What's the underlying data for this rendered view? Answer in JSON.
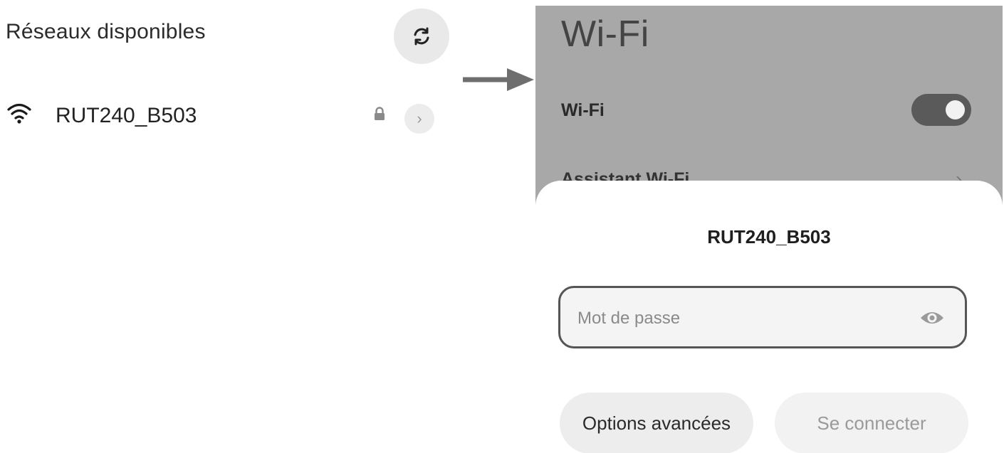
{
  "left_panel": {
    "section_title": "Réseaux disponibles",
    "refresh_icon": "refresh-icon",
    "network": {
      "name": "RUT240_B503",
      "signal_icon": "wifi-signal-icon",
      "secure_icon": "lock-icon",
      "detail_icon": "chevron-right-icon"
    }
  },
  "arrow_icon": "arrow-right-icon",
  "right_panel": {
    "screen_title": "Wi-Fi",
    "wifi_row": {
      "label": "Wi-Fi",
      "toggle_on": true
    },
    "assistant_row": {
      "label": "Assistant Wi-Fi"
    },
    "dialog": {
      "title": "RUT240_B503",
      "password_placeholder": "Mot de passe",
      "password_value": "",
      "visibility_icon": "eye-icon",
      "advanced_button": "Options avancées",
      "connect_button": "Se connecter"
    }
  },
  "colors": {
    "dim_overlay": "#a8a8a8",
    "toggle_track": "#5a5a5a",
    "field_border": "#555555",
    "button_bg": "#ededed",
    "disabled_text": "#9a9a9a"
  }
}
